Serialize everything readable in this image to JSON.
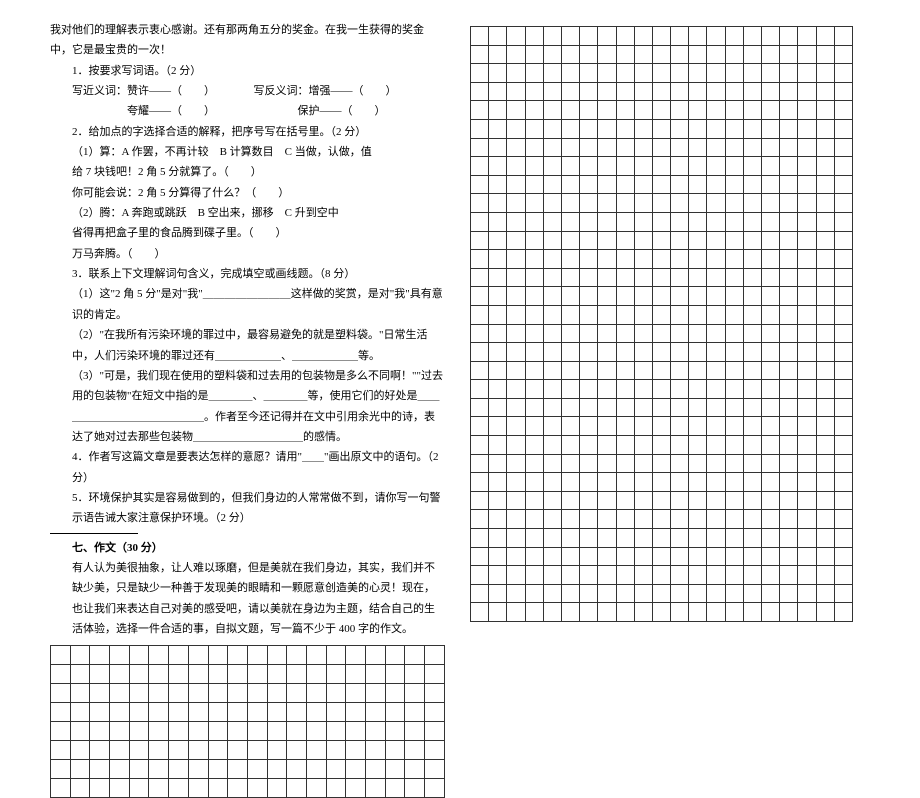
{
  "left": {
    "intro": "我对他们的理解表示衷心感谢。还有那两角五分的奖金。在我一生获得的奖金中，它是最宝贵的一次！",
    "q1_title": "1．按要求写词语。（2 分）",
    "q1_line1": "写近义词：赞许——（　　）　　　　写反义词：增强——（　　）",
    "q1_line2": "　　　　　夸耀——（　　）　　　　　　　　保护——（　　）",
    "q2_title": "2．给加点的字选择合适的解释，把序号写在括号里。（2 分）",
    "q2_a": "（1）算：A 作罢，不再计较　B 计算数目　C 当做，认做，值",
    "q2_a1": "给 7 块钱吧！2 角 5 分就算了。（　　）",
    "q2_a2": "你可能会说：2 角 5 分算得了什么？（　　）",
    "q2_b": "（2）腾：A 奔跑或跳跃　B 空出来，挪移　C 升到空中",
    "q2_b1": "省得再把盒子里的食品腾到碟子里。（　　）",
    "q2_b2": "万马奔腾。（　　）",
    "q3_title": "3．联系上下文理解词句含义，完成填空或画线题。（8 分）",
    "q3_1": "（1）这\"2 角 5 分\"是对\"我\"＿＿＿＿＿＿＿＿这样做的奖赏，是对\"我\"具有意识的肯定。",
    "q3_2": "（2）\"在我所有污染环境的罪过中，最容易避免的就是塑料袋。\"日常生活中，人们污染环境的罪过还有＿＿＿＿＿＿、＿＿＿＿＿＿等。",
    "q3_3a": "（3）\"可是，我们现在使用的塑料袋和过去用的包装物是多么不同啊！\"\"过去用的包装物\"在短文中指的是＿＿＿＿、＿＿＿＿等，使用它们的好处是＿＿＿＿＿＿＿＿＿＿＿＿＿＿。作者至今还记得并在文中引用余光中的诗，表达了她对过去那些包装物＿＿＿＿＿＿＿＿＿＿的感情。",
    "q4": "4．作者写这篇文章是要表达怎样的意愿？请用\"＿＿\"画出原文中的语句。（2 分）",
    "q5": "5．环境保护其实是容易做到的，但我们身边的人常常做不到，请你写一句警示语告诫大家注意保护环境。（2 分）",
    "section7_title": "七、作文（30 分）",
    "composition": "有人认为美很抽象，让人难以琢磨，但是美就在我们身边，其实，我们并不缺少美，只是缺少一种善于发现美的眼睛和一颗愿意创造美的心灵！现在，也让我们来表达自己对美的感受吧，请以美就在身边为主题，结合自己的生活体验，选择一件合适的事，自拟文题，写一篇不少于 400 字的作文。"
  }
}
